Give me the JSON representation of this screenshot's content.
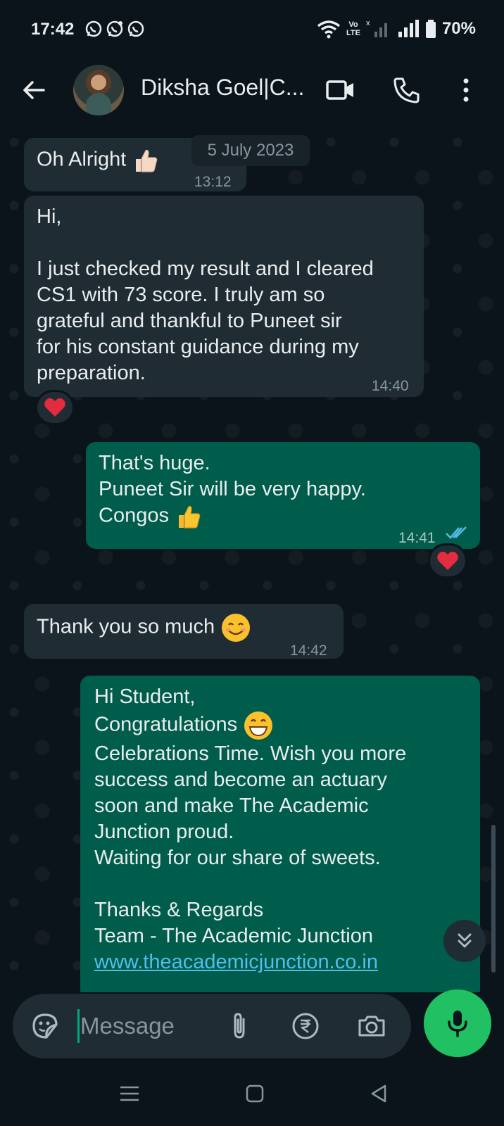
{
  "status_bar": {
    "time": "17:42",
    "battery": "70%",
    "volte_line1": "Vo",
    "volte_line2": "LTE",
    "app_icons": [
      "whatsapp-icon",
      "whatsapp-business-icon",
      "whatsapp-icon"
    ]
  },
  "header": {
    "contact_name": "Diksha Goel|C...",
    "icons": [
      "back-arrow-icon",
      "video-call-icon",
      "voice-call-icon",
      "more-options-icon"
    ]
  },
  "chat": {
    "date_chip": "5 July 2023",
    "messages": [
      {
        "direction": "in",
        "text": "Oh Alright",
        "emoji": "thumbs-up-light",
        "time": "13:12"
      },
      {
        "direction": "in",
        "text": "Hi,\n\nI just checked my result and I cleared\nCS1 with 73 score. I truly am so\ngrateful and thankful to Puneet sir\nfor his constant guidance during my\npreparation.",
        "time": "14:40",
        "reaction": "heart"
      },
      {
        "direction": "out",
        "text_lines": [
          "That's huge.",
          "Puneet Sir will be very happy.",
          "Congos"
        ],
        "emoji": "thumbs-up",
        "time": "14:41",
        "status": "read",
        "reaction": "heart"
      },
      {
        "direction": "in",
        "text": "Thank you so much",
        "emoji": "smiling-face",
        "time": "14:42"
      },
      {
        "direction": "out",
        "text_lines": [
          "Hi Student,",
          "Congratulations",
          "Celebrations Time. Wish you more\nsuccess and become an actuary\nsoon and make The Academic\nJunction proud.\nWaiting for our share of sweets.\n\nThanks & Regards\nTeam - The Academic Junction"
        ],
        "emoji": "grinning-face",
        "link": "www.theacademicjunction.co.in"
      }
    ]
  },
  "input": {
    "placeholder": "Message",
    "icons": [
      "sticker-icon",
      "attach-icon",
      "rupee-payment-icon",
      "camera-icon",
      "mic-icon"
    ]
  },
  "colors": {
    "background": "#0b141a",
    "incoming_bubble": "#202c33",
    "outgoing_bubble": "#005c4b",
    "accent": "#21c063",
    "read_tick": "#53bdeb",
    "link": "#53bdeb"
  }
}
